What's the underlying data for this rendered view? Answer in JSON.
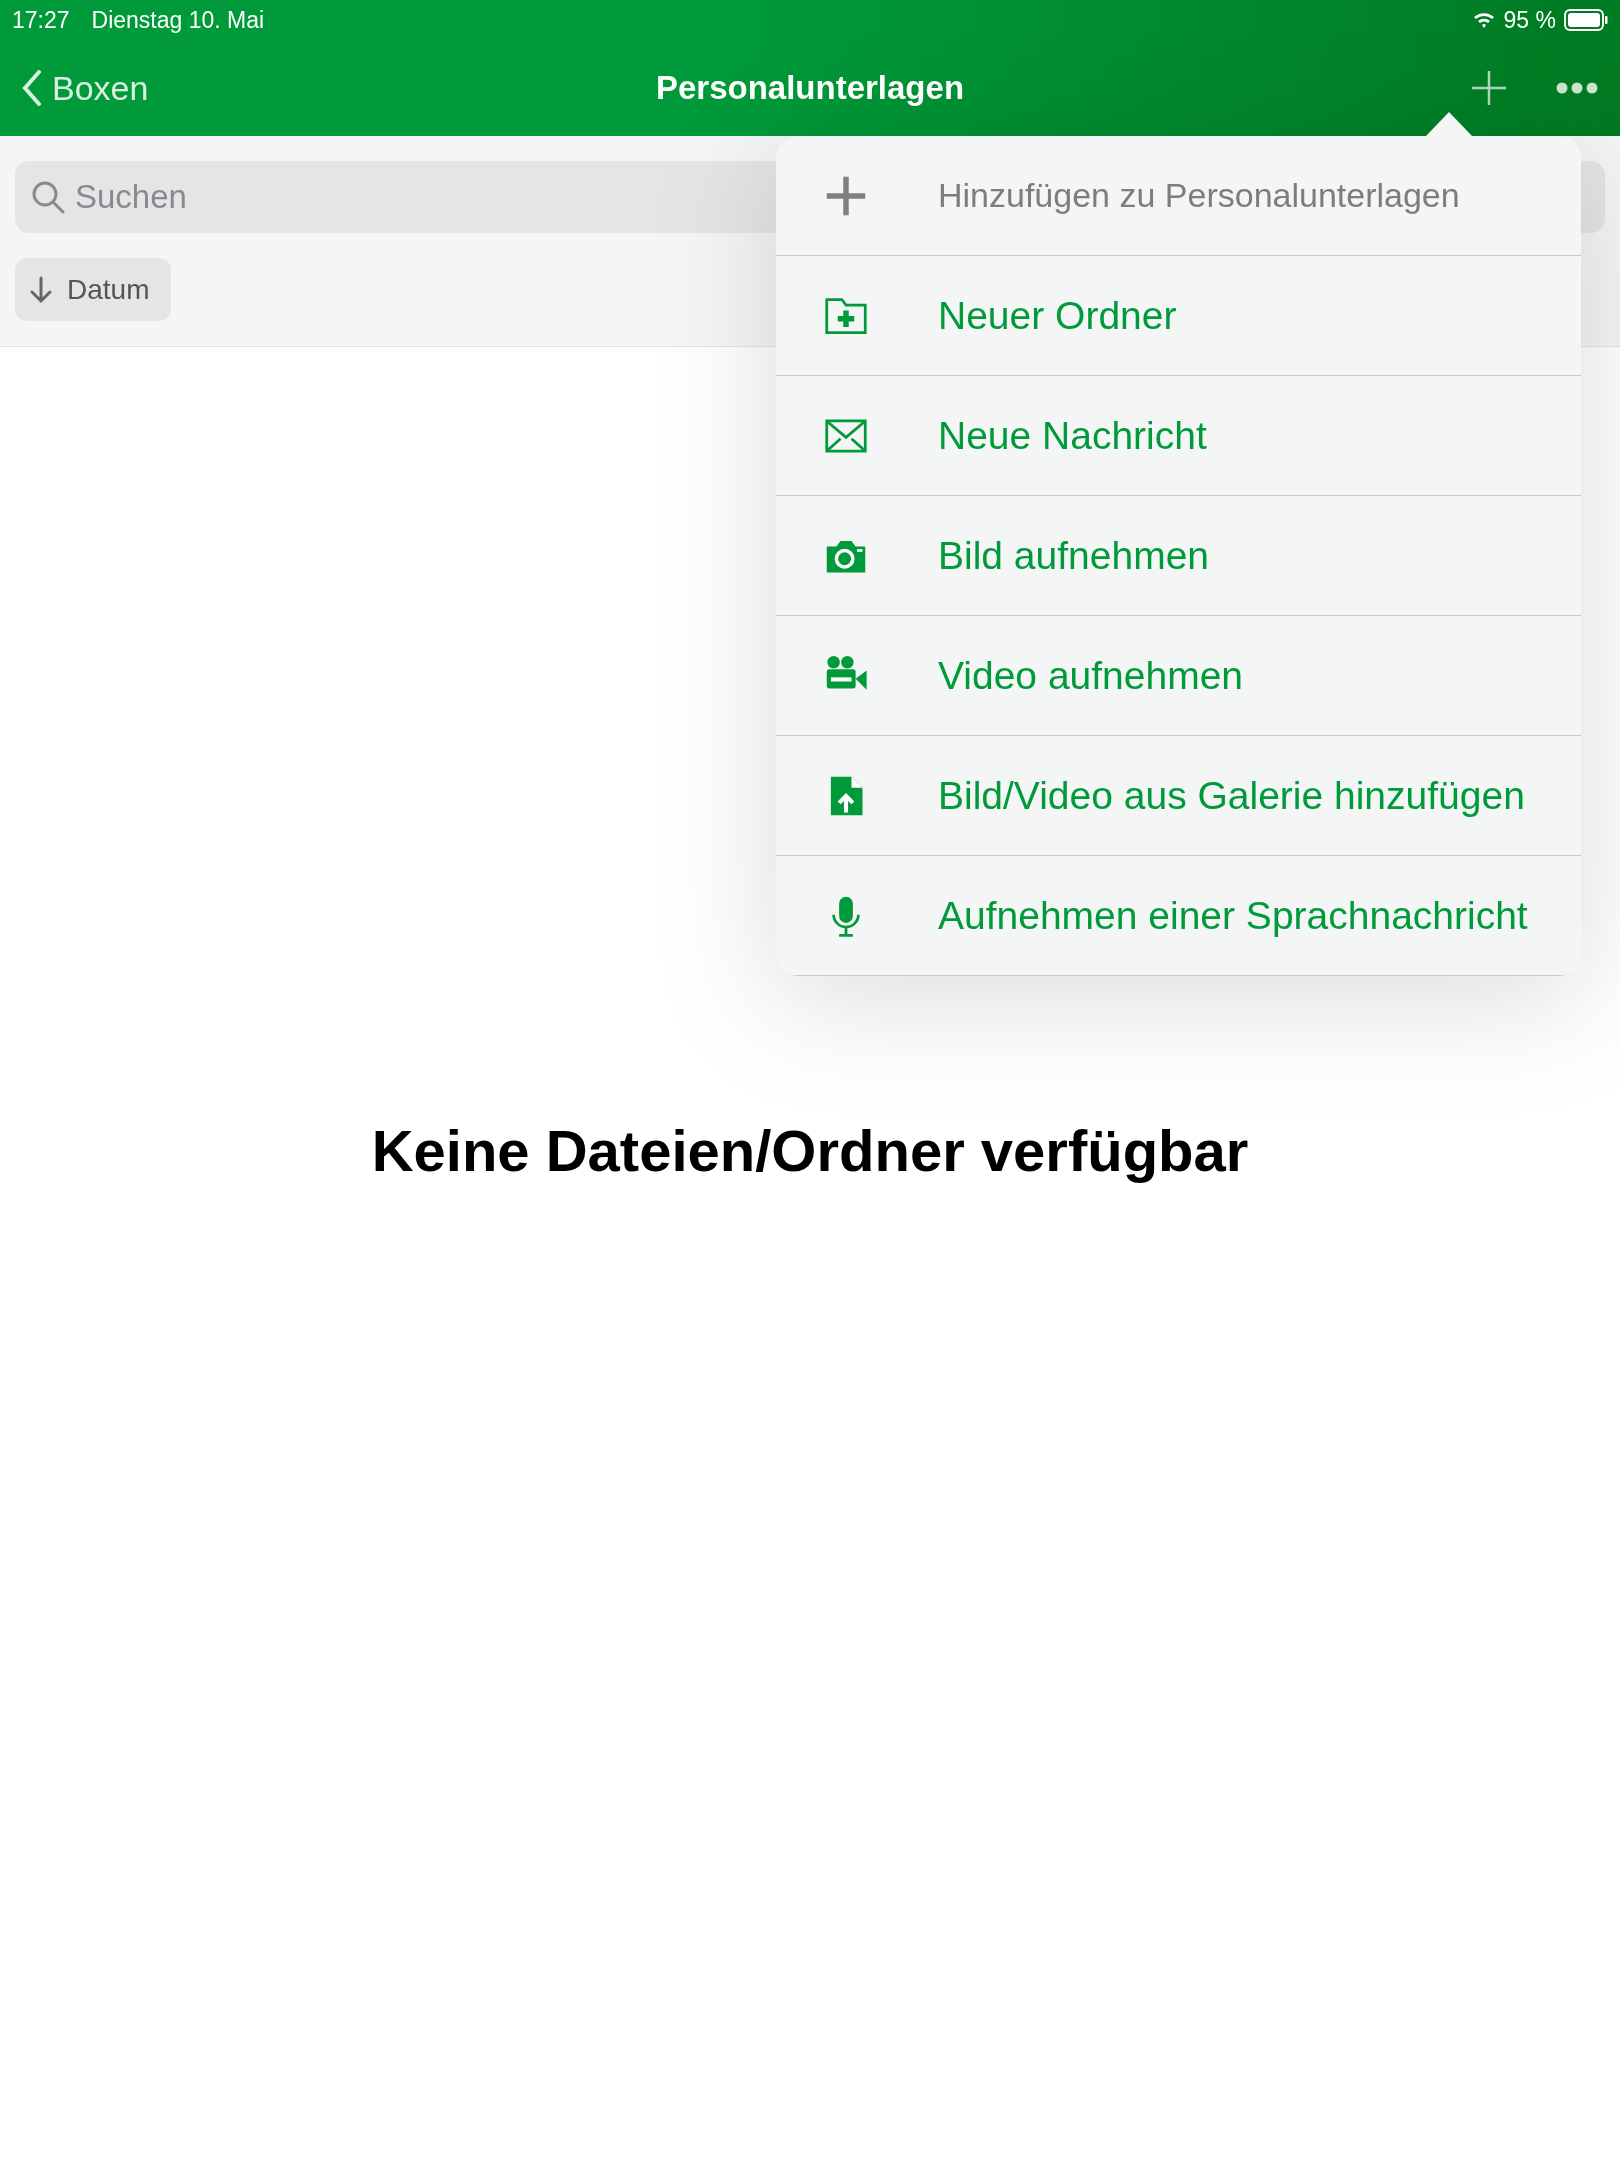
{
  "status_bar": {
    "time": "17:27",
    "date": "Dienstag 10. Mai",
    "battery": "95 %"
  },
  "nav_bar": {
    "back": "Boxen",
    "title": "Personalunterlagen"
  },
  "search": {
    "placeholder": "Suchen"
  },
  "sort_button": {
    "label": "Datum"
  },
  "add_menu": {
    "items": [
      {
        "kind": "header",
        "label": "Hinzufügen zu Personalunterlagen"
      },
      {
        "kind": "action",
        "label": "Neuer Ordner"
      },
      {
        "kind": "action",
        "label": "Neue Nachricht"
      },
      {
        "kind": "action",
        "label": "Bild aufnehmen"
      },
      {
        "kind": "action",
        "label": "Video aufnehmen"
      },
      {
        "kind": "action",
        "label": "Bild/Video aus Galerie hinzufügen"
      },
      {
        "kind": "action",
        "label": "Aufnehmen einer Sprachnachricht"
      }
    ]
  },
  "empty_message": "Keine Dateien/Ordner verfügbar"
}
